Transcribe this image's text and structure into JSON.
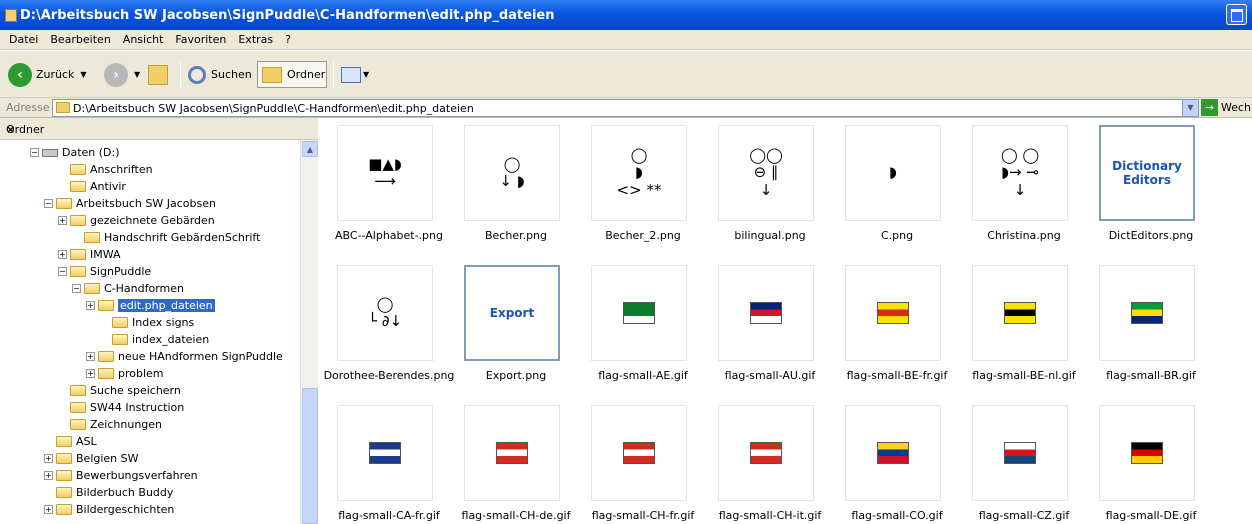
{
  "window": {
    "title": "D:\\Arbeitsbuch SW Jacobsen\\SignPuddle\\C-Handformen\\edit.php_dateien"
  },
  "menu": [
    "Datei",
    "Bearbeiten",
    "Ansicht",
    "Favoriten",
    "Extras",
    "?"
  ],
  "toolbar": {
    "back_label": "Zurück",
    "search_label": "Suchen",
    "folders_label": "Ordner"
  },
  "address": {
    "label": "Adresse",
    "value": "D:\\Arbeitsbuch SW Jacobsen\\SignPuddle\\C-Handformen\\edit.php_dateien",
    "go_label": "Wech"
  },
  "pane": {
    "title": "Ordner",
    "close": "×"
  },
  "tree": [
    {
      "label": "Daten (D:)",
      "toggle": "−",
      "drive": true
    },
    {
      "label": "Anschriften"
    },
    {
      "label": "Antivir"
    },
    {
      "label": "Arbeitsbuch SW Jacobsen",
      "toggle": "−"
    },
    {
      "label": "gezeichnete Gebärden",
      "toggle": "+"
    },
    {
      "label": "Handschrift GebärdenSchrift"
    },
    {
      "label": "IMWA",
      "toggle": "+"
    },
    {
      "label": "SignPuddle",
      "toggle": "−"
    },
    {
      "label": "C-Handformen",
      "toggle": "−"
    },
    {
      "label": "edit.php_dateien",
      "toggle": "+",
      "selected": true
    },
    {
      "label": "Index signs"
    },
    {
      "label": "index_dateien"
    },
    {
      "label": "neue HAndformen SignPuddle",
      "toggle": "+"
    },
    {
      "label": "problem",
      "toggle": "+"
    },
    {
      "label": "Suche speichern"
    },
    {
      "label": "SW44 Instruction"
    },
    {
      "label": "Zeichnungen"
    },
    {
      "label": "ASL"
    },
    {
      "label": "Belgien SW",
      "toggle": "+"
    },
    {
      "label": "Bewerbungsverfahren",
      "toggle": "+"
    },
    {
      "label": "Bilderbuch Buddy"
    },
    {
      "label": "Bildergeschichten",
      "toggle": "+"
    }
  ],
  "files": [
    {
      "name": "ABC--Alphabet-.png",
      "glyph": "■▲◗\n⟶"
    },
    {
      "name": "Becher.png",
      "glyph": "◯\n↓ ◗"
    },
    {
      "name": "Becher_2.png",
      "glyph": "◯\n◗\n<> **"
    },
    {
      "name": "bilingual.png",
      "glyph": "◯◯\n⊖ ∥\n↓"
    },
    {
      "name": "C.png",
      "glyph": "◗"
    },
    {
      "name": "Christina.png",
      "glyph": "◯ ◯\n◗→ ⊸\n↓"
    },
    {
      "name": "DictEditors.png",
      "dict": "Dictionary\nEditors"
    },
    {
      "name": "Dorothee-Berendes.png",
      "glyph": "◯\n└ ∂↓"
    },
    {
      "name": "Export.png",
      "dict": "Export"
    },
    {
      "name": "flag-small-AE.gif",
      "flag": [
        "#0a7d2a",
        "#0a7d2a",
        "#ffffff"
      ]
    },
    {
      "name": "flag-small-AU.gif",
      "flag": [
        "#00247d",
        "#cf142b",
        "#ffffff"
      ]
    },
    {
      "name": "flag-small-BE-fr.gif",
      "flag": [
        "#fce200",
        "#d52b1e",
        "#fce200"
      ]
    },
    {
      "name": "flag-small-BE-nl.gif",
      "flag": [
        "#fce200",
        "#000000",
        "#fce200"
      ]
    },
    {
      "name": "flag-small-BR.gif",
      "flag": [
        "#009b3a",
        "#fedf00",
        "#002776"
      ]
    },
    {
      "name": "flag-small-CA-fr.gif",
      "flag": [
        "#1d3b8e",
        "#ffffff",
        "#1d3b8e"
      ]
    },
    {
      "name": "flag-small-CH-de.gif",
      "flag": [
        "#d52b1e",
        "#ffffff",
        "#d52b1e"
      ]
    },
    {
      "name": "flag-small-CH-fr.gif",
      "flag": [
        "#d52b1e",
        "#ffffff",
        "#d52b1e"
      ]
    },
    {
      "name": "flag-small-CH-it.gif",
      "flag": [
        "#d52b1e",
        "#ffffff",
        "#d52b1e"
      ]
    },
    {
      "name": "flag-small-CO.gif",
      "flag": [
        "#fcd116",
        "#003893",
        "#ce1126"
      ]
    },
    {
      "name": "flag-small-CZ.gif",
      "flag": [
        "#ffffff",
        "#d7141a",
        "#11457e"
      ]
    },
    {
      "name": "flag-small-DE.gif",
      "flag": [
        "#000000",
        "#dd0000",
        "#ffce00"
      ]
    }
  ]
}
